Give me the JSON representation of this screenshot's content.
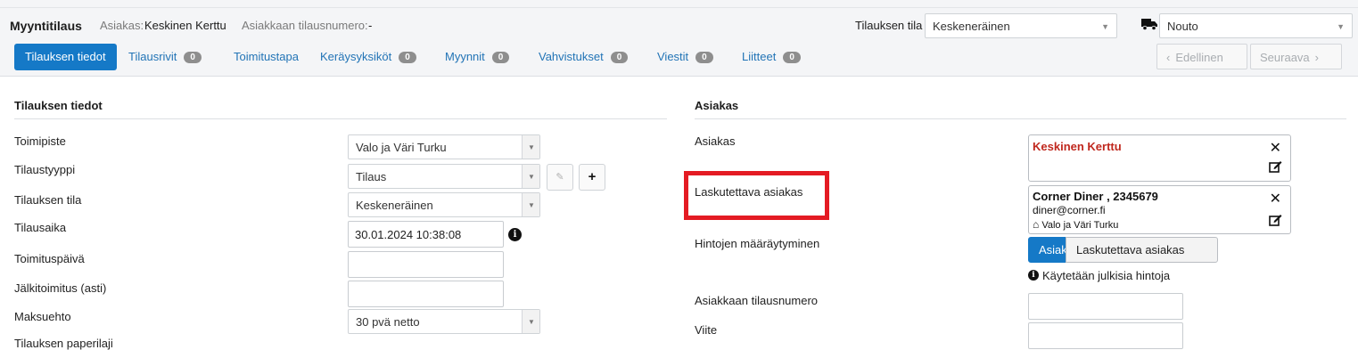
{
  "header": {
    "title": "Myyntitilaus",
    "customer_label": "Asiakas:",
    "customer_name": "Keskinen Kerttu",
    "customer_order_label": "Asiakkaan tilausnumero:",
    "customer_order_value": "-",
    "order_state_label": "Tilauksen tila",
    "order_state_value": "Keskeneräinen",
    "delivery_icon": "truck-icon",
    "delivery_value": "Nouto"
  },
  "tabs": [
    {
      "label": "Tilauksen tiedot",
      "active": true
    },
    {
      "label": "Tilausrivit",
      "badge": "0"
    },
    {
      "label": "Toimitustapa"
    },
    {
      "label": "Keräysyksiköt",
      "badge": "0"
    },
    {
      "label": "Myynnit",
      "badge": "0"
    },
    {
      "label": "Vahvistukset",
      "badge": "0"
    },
    {
      "label": "Viestit",
      "badge": "0"
    },
    {
      "label": "Liitteet",
      "badge": "0"
    }
  ],
  "pager": {
    "prev_label": "Edellinen",
    "next_label": "Seuraava"
  },
  "order_info": {
    "section_title": "Tilauksen tiedot",
    "fields": {
      "toimipiste_label": "Toimipiste",
      "toimipiste_value": "Valo ja Väri Turku",
      "tilaustyyppi_label": "Tilaustyyppi",
      "tilaustyyppi_value": "Tilaus",
      "tilauksen_tila_label": "Tilauksen tila",
      "tilauksen_tila_value": "Keskeneräinen",
      "tilausaika_label": "Tilausaika",
      "tilausaika_value": "30.01.2024 10:38:08",
      "toimituspaiva_label": "Toimituspäivä",
      "toimituspaiva_value": "",
      "jalkitoimitus_label": "Jälkitoimitus (asti)",
      "jalkitoimitus_value": "",
      "maksuehto_label": "Maksuehto",
      "maksuehto_value": "30 pvä netto",
      "cut_off_label": "Tilauksen paperilaji"
    }
  },
  "customer": {
    "section_title": "Asiakas",
    "asiakas_label": "Asiakas",
    "asiakas_name": "Keskinen Kerttu",
    "asiakas_color": "#c0281e",
    "laskutettava_label": "Laskutettava asiakas",
    "billing_name": "Corner Diner , 2345679",
    "billing_email": "diner@corner.fi",
    "billing_store": "Valo ja Väri Turku",
    "hinnat_label": "Hintojen määräytyminen",
    "seg_on": "Asiakas",
    "seg_off": "Laskutettava asiakas",
    "public_prices_note": "Käytetään julkisia hintoja",
    "tilausnumero_label": "Asiakkaan tilausnumero",
    "viite_label": "Viite"
  },
  "colors": {
    "accent": "#1579c7",
    "link": "#2274b6",
    "highlight": "#e41b23"
  }
}
